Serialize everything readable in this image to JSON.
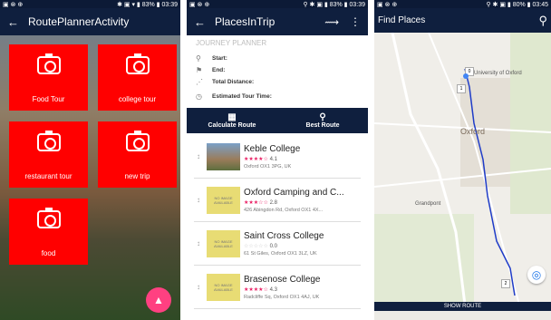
{
  "phone1": {
    "status_time": "03:39",
    "status_battery": "83%",
    "title": "RoutePlannerActivity",
    "tiles": [
      {
        "label": "Food Tour"
      },
      {
        "label": "college tour"
      },
      {
        "label": "restaurant tour"
      },
      {
        "label": "new trip"
      },
      {
        "label": "food"
      }
    ],
    "fab_icon": "navigation-icon"
  },
  "phone2": {
    "status_time": "03:39",
    "status_battery": "83%",
    "title": "PlacesInTrip",
    "journey": {
      "heading": "JOURNEY PLANNER",
      "start": "Start:",
      "end": "End:",
      "distance": "Total Distance:",
      "time": "Estimated Tour Time:"
    },
    "actions": {
      "calculate": "Calculate Route",
      "best": "Best Route"
    },
    "places": [
      {
        "name": "Keble College",
        "rating": "4.1",
        "stars": "★★★★☆",
        "address": "Oxford OX1 3PG, UK",
        "has_image": true,
        "no_image": ""
      },
      {
        "name": "Oxford Camping and C...",
        "rating": "2.8",
        "stars": "★★★☆☆",
        "address": "426 Abingdon Rd, Oxford OX1 4X...",
        "has_image": false,
        "no_image": "NO IMAGE AVAILABLE"
      },
      {
        "name": "Saint Cross College",
        "rating": "0.0",
        "stars": "☆☆☆☆☆",
        "address": "61 St Giles, Oxford OX1 3LZ, UK",
        "has_image": false,
        "no_image": "NO IMAGE AVAILABLE"
      },
      {
        "name": "Brasenose College",
        "rating": "4.3",
        "stars": "★★★★☆",
        "address": "Radcliffe Sq, Oxford OX1 4AJ, UK",
        "has_image": false,
        "no_image": "NO IMAGE AVAILABLE"
      }
    ]
  },
  "phone3": {
    "status_time": "03:45",
    "status_battery": "80%",
    "title": "Find Places",
    "labels": {
      "university": "University of Oxford",
      "oxford": "Oxford",
      "grandpont": "Grandpont"
    },
    "markers": [
      "0",
      "1",
      "2"
    ],
    "show_route": "SHOW ROUTE"
  }
}
